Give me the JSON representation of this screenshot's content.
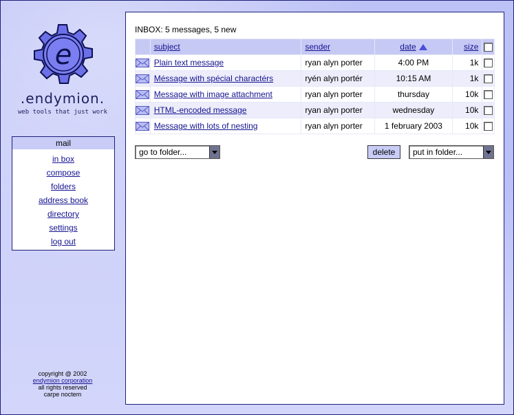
{
  "brand": {
    "name": ".endymion.",
    "tagline": "web tools that just work",
    "logo_letter": "e"
  },
  "nav": {
    "header": "mail",
    "items": [
      {
        "label": "in box"
      },
      {
        "label": "compose"
      },
      {
        "label": "folders"
      },
      {
        "label": "address book"
      },
      {
        "label": "directory"
      },
      {
        "label": "settings"
      },
      {
        "label": "log out"
      }
    ]
  },
  "footer": {
    "copyright": "copyright @ 2002",
    "company": "endymion corporation",
    "rights": "all rights reserved",
    "motto": "carpe noctem"
  },
  "inbox": {
    "title": "INBOX: 5 messages, 5 new",
    "columns": {
      "subject": "subject",
      "sender": "sender",
      "date": "date",
      "size": "size"
    },
    "sort_column": "date",
    "messages": [
      {
        "subject": "Plain text message",
        "sender": "ryan alyn porter",
        "date": "4:00 PM",
        "size": "1k"
      },
      {
        "subject": "Méssage with spécial charactérs",
        "sender": "ryén alyn portér",
        "date": "10:15 AM",
        "size": "1k"
      },
      {
        "subject": "Message with image attachment",
        "sender": "ryan alyn porter",
        "date": "thursday",
        "size": "10k"
      },
      {
        "subject": "HTML-encoded message",
        "sender": "ryan alyn porter",
        "date": "wednesday",
        "size": "10k"
      },
      {
        "subject": "Message with lots of nesting",
        "sender": "ryan alyn porter",
        "date": "1 february 2003",
        "size": "10k"
      }
    ]
  },
  "actions": {
    "go_to_folder": "go to folder...",
    "delete": "delete",
    "put_in_folder": "put in folder..."
  },
  "colors": {
    "accent": "#c8ccf6",
    "link": "#14128f",
    "border": "#1b1e7a"
  }
}
